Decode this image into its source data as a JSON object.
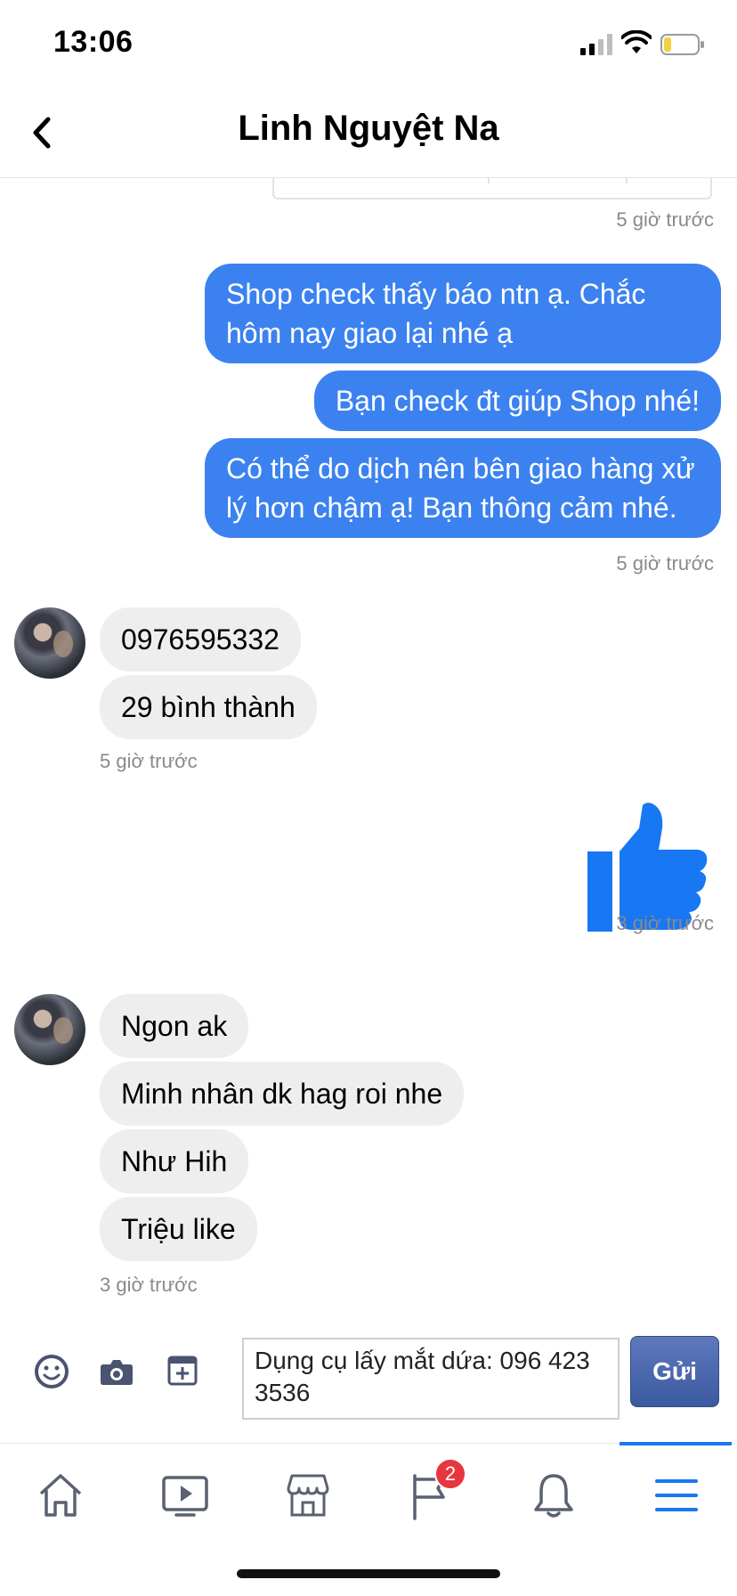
{
  "status_bar": {
    "time": "13:06"
  },
  "header": {
    "title": "Linh Nguyệt Na"
  },
  "messages": {
    "ts_top": "5 giờ trước",
    "out1": "Shop check thấy báo ntn ạ. Chắc hôm nay giao lại nhé ạ",
    "out2": "Bạn check đt giúp Shop nhé!",
    "out3": "Có thể do dịch nên bên giao hàng xử lý hơn chậm ạ! Bạn thông cảm nhé.",
    "ts_out_group": "5 giờ trước",
    "in1": "0976595332",
    "in2": "29 bình thành",
    "ts_in_group1": "5 giờ trước",
    "ts_like": "3 giờ trước",
    "in3": "Ngon ak",
    "in4": "Minh nhân dk hag roi nhe",
    "in5": "Như Hih",
    "in6": "Triệu like",
    "ts_in_group2": "3 giờ trước"
  },
  "composer": {
    "input_value": "Dụng cụ lấy mắt dứa: 096 423 3536",
    "send_label": "Gửi"
  },
  "bottom_nav": {
    "notifications_badge": "2",
    "items": [
      "home-icon",
      "video-icon",
      "marketplace-icon",
      "pages-flag-icon",
      "bell-icon",
      "menu-icon"
    ]
  },
  "colors": {
    "outgoing_bubble": "#3b82f0",
    "incoming_bubble": "#eeeeee",
    "like_icon": "#1877f2",
    "badge": "#e8363f",
    "send_button": "#3b5a9f"
  }
}
